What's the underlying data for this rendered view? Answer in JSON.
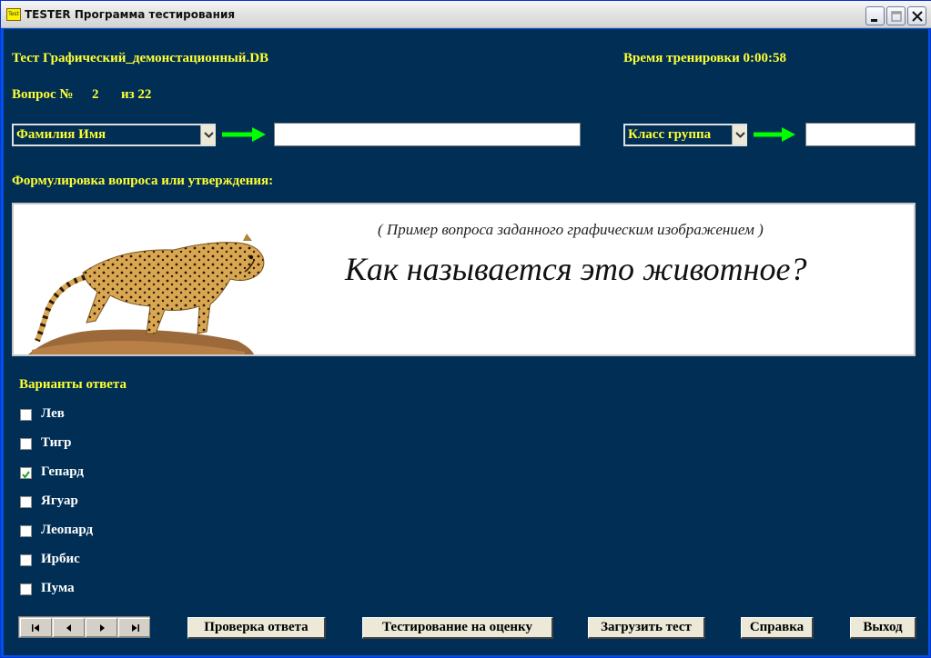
{
  "window": {
    "title": "TESTER Программа  тестирования",
    "app_icon_text": "Test"
  },
  "header": {
    "test_name": "Тест Графический_демонстационный.DB",
    "timer": "Время тренировки 0:00:58",
    "question_label": "Вопрос №",
    "question_number": "2",
    "question_total": "из 22"
  },
  "inputs": {
    "name_combo": "Фамилия Имя",
    "name_value": "",
    "class_combo": "Класс группа",
    "class_value": ""
  },
  "question": {
    "heading": "Формулировка вопроса или утверждения:",
    "subtitle": "( Пример вопроса заданного графическим изображением )",
    "text": "Как  называется это животное?"
  },
  "answers": {
    "heading": "Варианты ответа",
    "options": [
      {
        "label": "Лев",
        "checked": false
      },
      {
        "label": "Тигр",
        "checked": false
      },
      {
        "label": "Гепард",
        "checked": true
      },
      {
        "label": "Ягуар",
        "checked": false
      },
      {
        "label": "Леопард",
        "checked": false
      },
      {
        "label": "Ирбис",
        "checked": false
      },
      {
        "label": "Пума",
        "checked": false
      }
    ]
  },
  "buttons": {
    "check": "Проверка ответа",
    "graded": "Тестирование на оценку",
    "load": "Загрузить тест",
    "help": "Справка",
    "exit": "Выход"
  },
  "navigation": [
    "first",
    "prev",
    "next",
    "last"
  ],
  "colors": {
    "background": "#002e55",
    "label_text": "#ffff33",
    "arrow": "#00ff00",
    "option_text": "#ffffff"
  }
}
